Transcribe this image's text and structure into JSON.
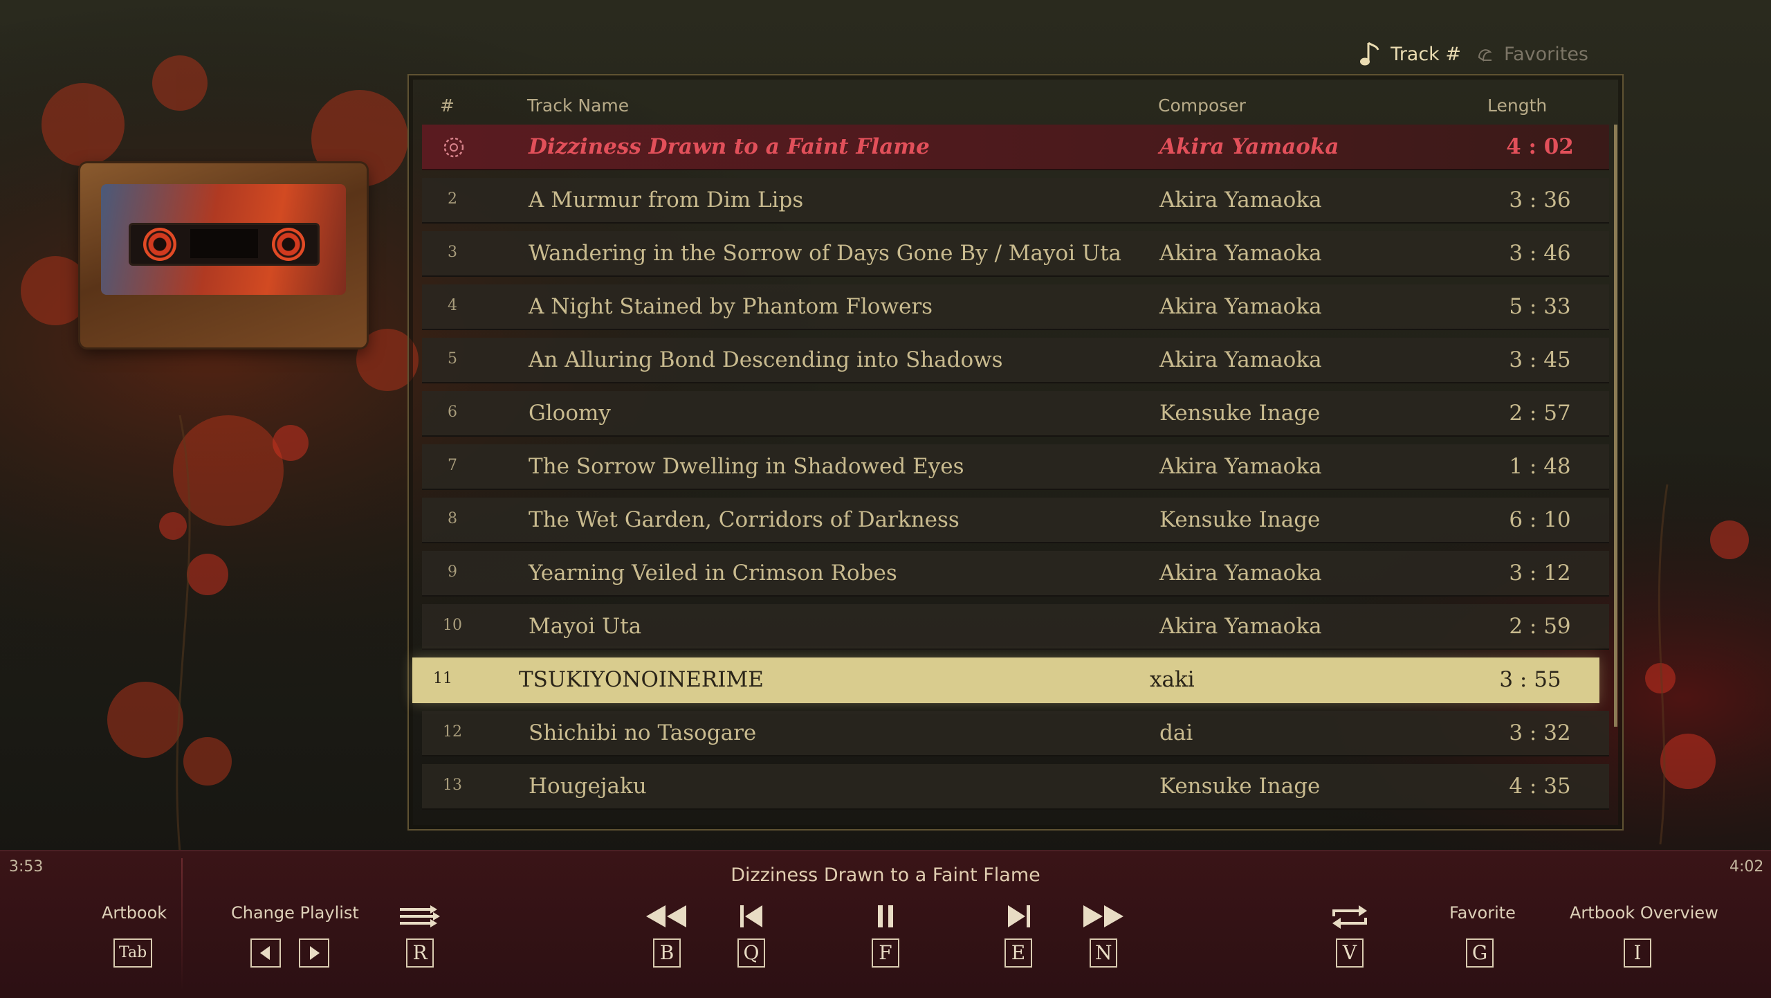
{
  "sort_tabs": {
    "track_label": "Track #",
    "favorites_label": "Favorites"
  },
  "table": {
    "headers": {
      "num": "#",
      "name": "Track Name",
      "composer": "Composer",
      "length": "Length"
    },
    "rows": [
      {
        "num": "",
        "name": "Dizziness Drawn to a Faint Flame",
        "composer": "Akira Yamaoka",
        "length": "4 : 02",
        "state": "playing"
      },
      {
        "num": "2",
        "name": "A Murmur from Dim Lips",
        "composer": "Akira Yamaoka",
        "length": "3 : 36",
        "state": ""
      },
      {
        "num": "3",
        "name": "Wandering in the Sorrow of Days Gone By / Mayoi Uta",
        "composer": "Akira Yamaoka",
        "length": "3 : 46",
        "state": ""
      },
      {
        "num": "4",
        "name": "A Night Stained by Phantom Flowers",
        "composer": "Akira Yamaoka",
        "length": "5 : 33",
        "state": ""
      },
      {
        "num": "5",
        "name": "An Alluring Bond Descending into Shadows",
        "composer": "Akira Yamaoka",
        "length": "3 : 45",
        "state": ""
      },
      {
        "num": "6",
        "name": "Gloomy",
        "composer": "Kensuke Inage",
        "length": "2 : 57",
        "state": ""
      },
      {
        "num": "7",
        "name": "The Sorrow Dwelling in Shadowed Eyes",
        "composer": "Akira Yamaoka",
        "length": "1 : 48",
        "state": ""
      },
      {
        "num": "8",
        "name": "The Wet Garden, Corridors of Darkness",
        "composer": "Kensuke Inage",
        "length": "6 : 10",
        "state": ""
      },
      {
        "num": "9",
        "name": "Yearning Veiled in Crimson Robes",
        "composer": "Akira Yamaoka",
        "length": "3 : 12",
        "state": ""
      },
      {
        "num": "10",
        "name": "Mayoi Uta",
        "composer": "Akira Yamaoka",
        "length": "2 : 59",
        "state": ""
      },
      {
        "num": "11",
        "name": "TSUKIYONOINERIME",
        "composer": "xaki",
        "length": "3 : 55",
        "state": "selected"
      },
      {
        "num": "12",
        "name": "Shichibi no Tasogare",
        "composer": "dai",
        "length": "3 : 32",
        "state": ""
      },
      {
        "num": "13",
        "name": "Hougejaku",
        "composer": "Kensuke Inage",
        "length": "4 : 35",
        "state": ""
      }
    ]
  },
  "player": {
    "elapsed": "3:53",
    "total": "4:02",
    "now_playing": "Dizziness Drawn to a Faint Flame"
  },
  "controls": {
    "artbook_label": "Artbook",
    "artbook_key": "Tab",
    "change_playlist_label": "Change Playlist",
    "shuffle_key": "R",
    "rewind_key": "B",
    "previous_key": "Q",
    "pause_key": "F",
    "next_key": "E",
    "fast_forward_key": "N",
    "repeat_key": "V",
    "favorite_label": "Favorite",
    "favorite_key": "G",
    "artbook_overview_label": "Artbook Overview",
    "artbook_overview_key": "I"
  },
  "colors": {
    "accent_gold": "#d9cc8e",
    "playing_red": "#e2505a",
    "bottom_bar": "#3a1417"
  }
}
